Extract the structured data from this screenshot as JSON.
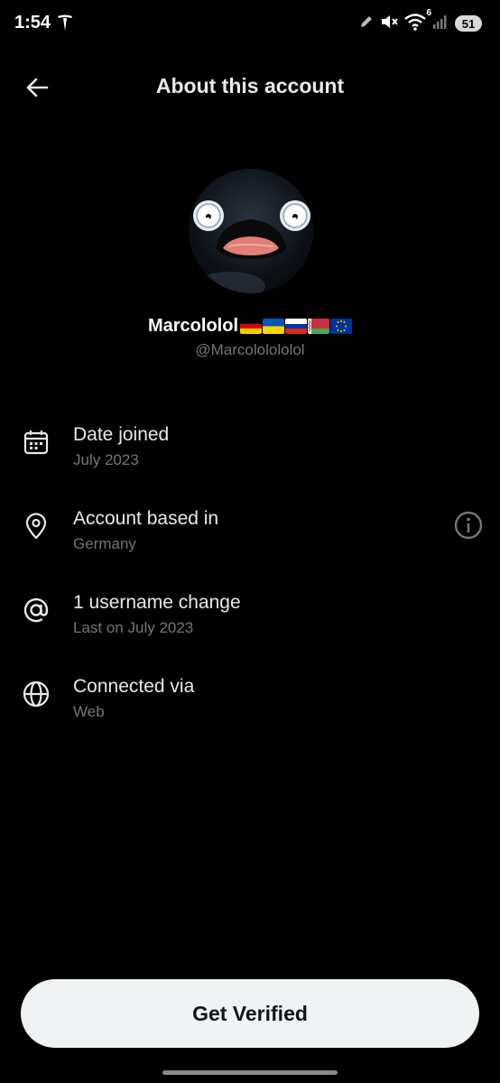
{
  "status_bar": {
    "time": "1:54",
    "battery": "51",
    "wifi_badge": "6",
    "icons": [
      "tesla-icon",
      "edit-pencil-icon",
      "mute-vibrate-icon",
      "wifi-icon",
      "signal-icon",
      "battery-icon"
    ]
  },
  "header": {
    "title": "About this account",
    "back_icon": "arrow-left-icon"
  },
  "profile": {
    "display_name": "Marcololol",
    "flags": [
      "Germany",
      "Ukraine",
      "Russia",
      "Belarus",
      "European Union"
    ],
    "handle": "@Marcololololol"
  },
  "rows": [
    {
      "icon": "calendar-icon",
      "title": "Date joined",
      "subtitle": "July 2023"
    },
    {
      "icon": "location-pin-icon",
      "title": "Account based in",
      "subtitle": "Germany",
      "trailing_icon": "info-icon"
    },
    {
      "icon": "at-sign-icon",
      "title": "1 username change",
      "subtitle": "Last on July 2023"
    },
    {
      "icon": "globe-icon",
      "title": "Connected via",
      "subtitle": "Web"
    }
  ],
  "footer": {
    "button_label": "Get Verified"
  },
  "colors": {
    "background": "#000000",
    "primary_text": "#e7e9ea",
    "secondary_text": "#71767b",
    "button_bg": "#eff3f4",
    "button_text": "#0f1419"
  }
}
